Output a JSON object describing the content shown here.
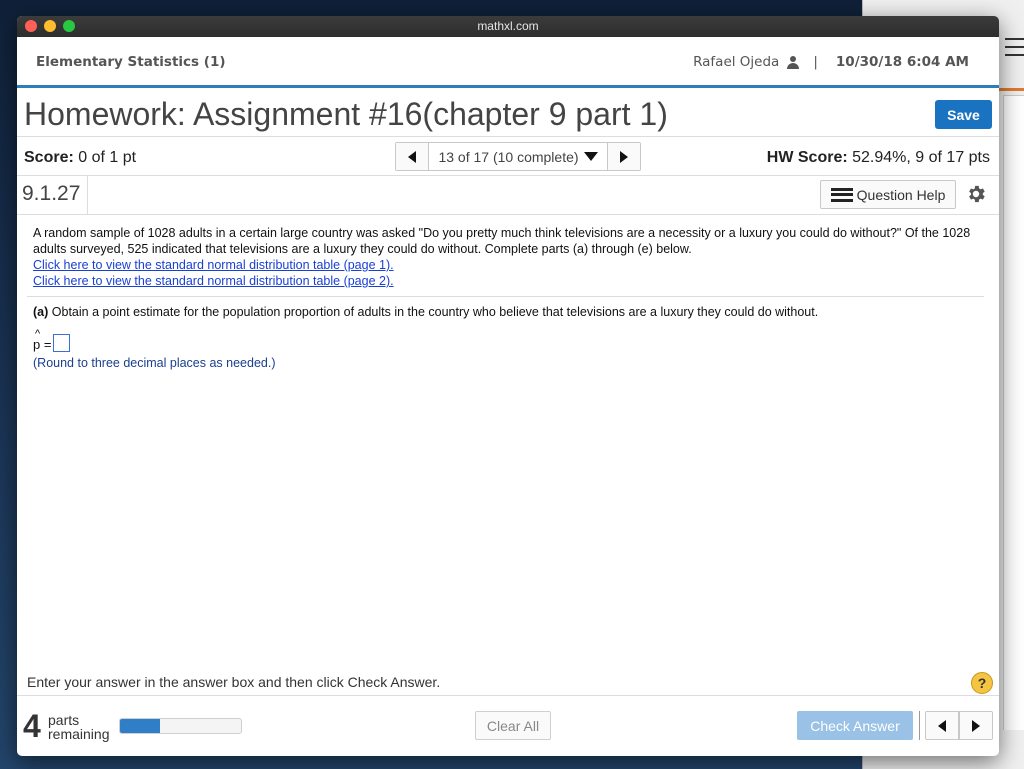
{
  "browser": {
    "title": "mathxl.com"
  },
  "header": {
    "course": "Elementary Statistics (1)",
    "user_name": "Rafael Ojeda",
    "separator": "|",
    "datetime": "10/30/18 6:04 AM"
  },
  "homework": {
    "title": "Homework: Assignment #16(chapter 9 part 1)",
    "save_label": "Save"
  },
  "score_bar": {
    "score_label": "Score:",
    "score_value": "0 of 1 pt",
    "navigator_text": "13 of 17 (10 complete)",
    "hw_score_label": "HW Score:",
    "hw_score_value": "52.94%, 9 of 17 pts"
  },
  "question": {
    "id": "9.1.27",
    "help_label": "Question Help",
    "text": "A random sample of 1028 adults in a certain large country was asked \"Do you pretty much think televisions are a necessity or a luxury you could do without?\" Of the 1028 adults surveyed, 525 indicated that televisions are a luxury they could do without. Complete parts (a) through (e) below.",
    "link1": "Click here to view the standard normal distribution table (page 1).",
    "link2": "Click here to view the standard normal distribution table (page 2).",
    "part_a_label": "(a)",
    "part_a_text": "Obtain a point estimate for the population proportion of adults in the country who believe that televisions are a luxury they could do without.",
    "answer_prefix": "p =",
    "answer_hat": "^",
    "answer_value": "",
    "hint": "(Round to three decimal places as needed.)"
  },
  "footer": {
    "instructions": "Enter your answer in the answer box and then click Check Answer.",
    "help_glyph": "?",
    "parts_count": "4",
    "parts_word1": "parts",
    "parts_word2": "remaining",
    "progress_fraction": 0.33,
    "clear_label": "Clear All",
    "check_label": "Check Answer"
  },
  "colors": {
    "accent": "#2b7fb8",
    "save_button": "#1a73c0",
    "check_button": "#99c2e6",
    "link": "#1a3fd4",
    "progress_fill": "#2f7ec7"
  },
  "icons": {
    "user": "user-icon",
    "list": "list-icon",
    "settings": "gear-icon",
    "help": "help-icon"
  }
}
